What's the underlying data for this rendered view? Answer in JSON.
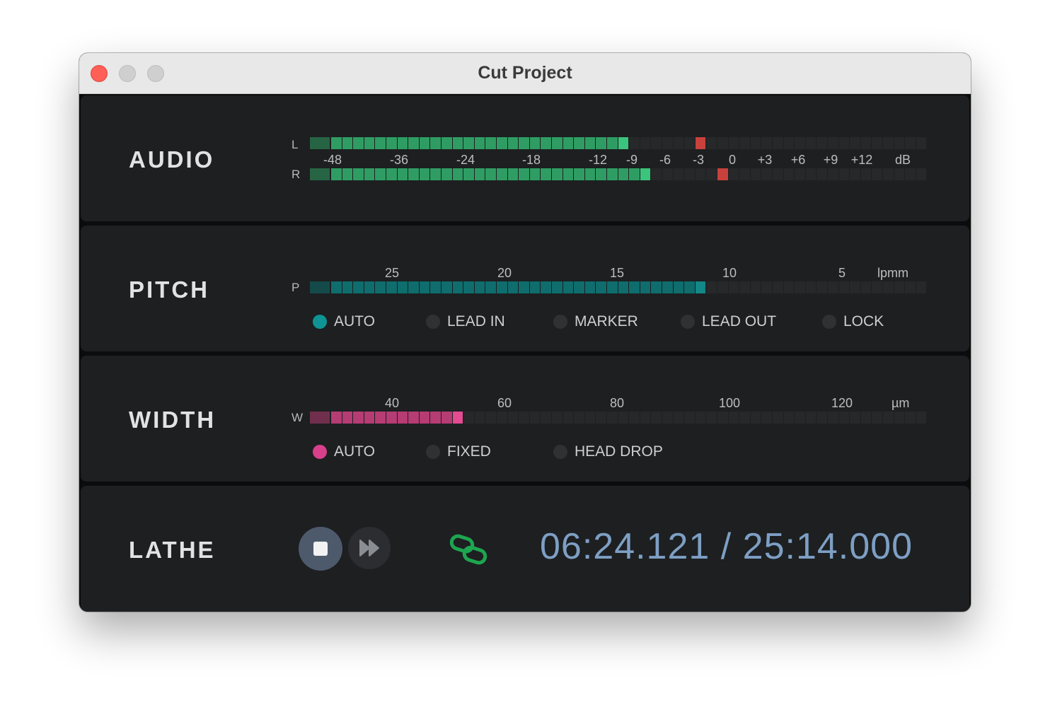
{
  "window": {
    "title": "Cut Project",
    "controls": [
      "close",
      "minimize",
      "zoom"
    ]
  },
  "colors": {
    "audio_on": "#2f9d63",
    "audio_peak_hold": "#c8413c",
    "pitch_on": "#0f6d6d",
    "width_on": "#b63c74",
    "segment_off": "#262829",
    "timecode": "#7e9fc4",
    "link_icon": "#1da550",
    "pitch_auto_dot": "#0e9494",
    "width_auto_dot": "#d9408a"
  },
  "audio": {
    "title": "AUDIO",
    "unit": "dB",
    "scale": [
      "-48",
      "-36",
      "-24",
      "-18",
      "-12",
      "-9",
      "-6",
      "-3",
      "0",
      "+3",
      "+6",
      "+9",
      "+12"
    ],
    "channels": [
      {
        "label": "L",
        "level_segments": 28,
        "peak_segment": 34,
        "total_segments": 55
      },
      {
        "label": "R",
        "level_segments": 30,
        "peak_segment": 36,
        "total_segments": 55
      }
    ]
  },
  "pitch": {
    "title": "PITCH",
    "channel": "P",
    "unit": "lpmm",
    "scale": [
      "25",
      "20",
      "15",
      "10",
      "5"
    ],
    "level_segments": 35,
    "total_segments": 55,
    "modes": [
      {
        "label": "AUTO",
        "active": true
      },
      {
        "label": "LEAD IN",
        "active": false
      },
      {
        "label": "MARKER",
        "active": false
      },
      {
        "label": "LEAD OUT",
        "active": false
      },
      {
        "label": "LOCK",
        "active": false
      }
    ]
  },
  "width": {
    "title": "WIDTH",
    "channel": "W",
    "unit": "µm",
    "scale": [
      "40",
      "60",
      "80",
      "100",
      "120"
    ],
    "level_segments": 13,
    "total_segments": 55,
    "modes": [
      {
        "label": "AUTO",
        "active": true
      },
      {
        "label": "FIXED",
        "active": false
      },
      {
        "label": "HEAD DROP",
        "active": false
      }
    ]
  },
  "lathe": {
    "title": "LATHE",
    "stop_icon": "stop-icon",
    "fast_forward_icon": "fast-forward-icon",
    "link_icon": "link-icon",
    "timecode": "06:24.121 / 25:14.000"
  }
}
